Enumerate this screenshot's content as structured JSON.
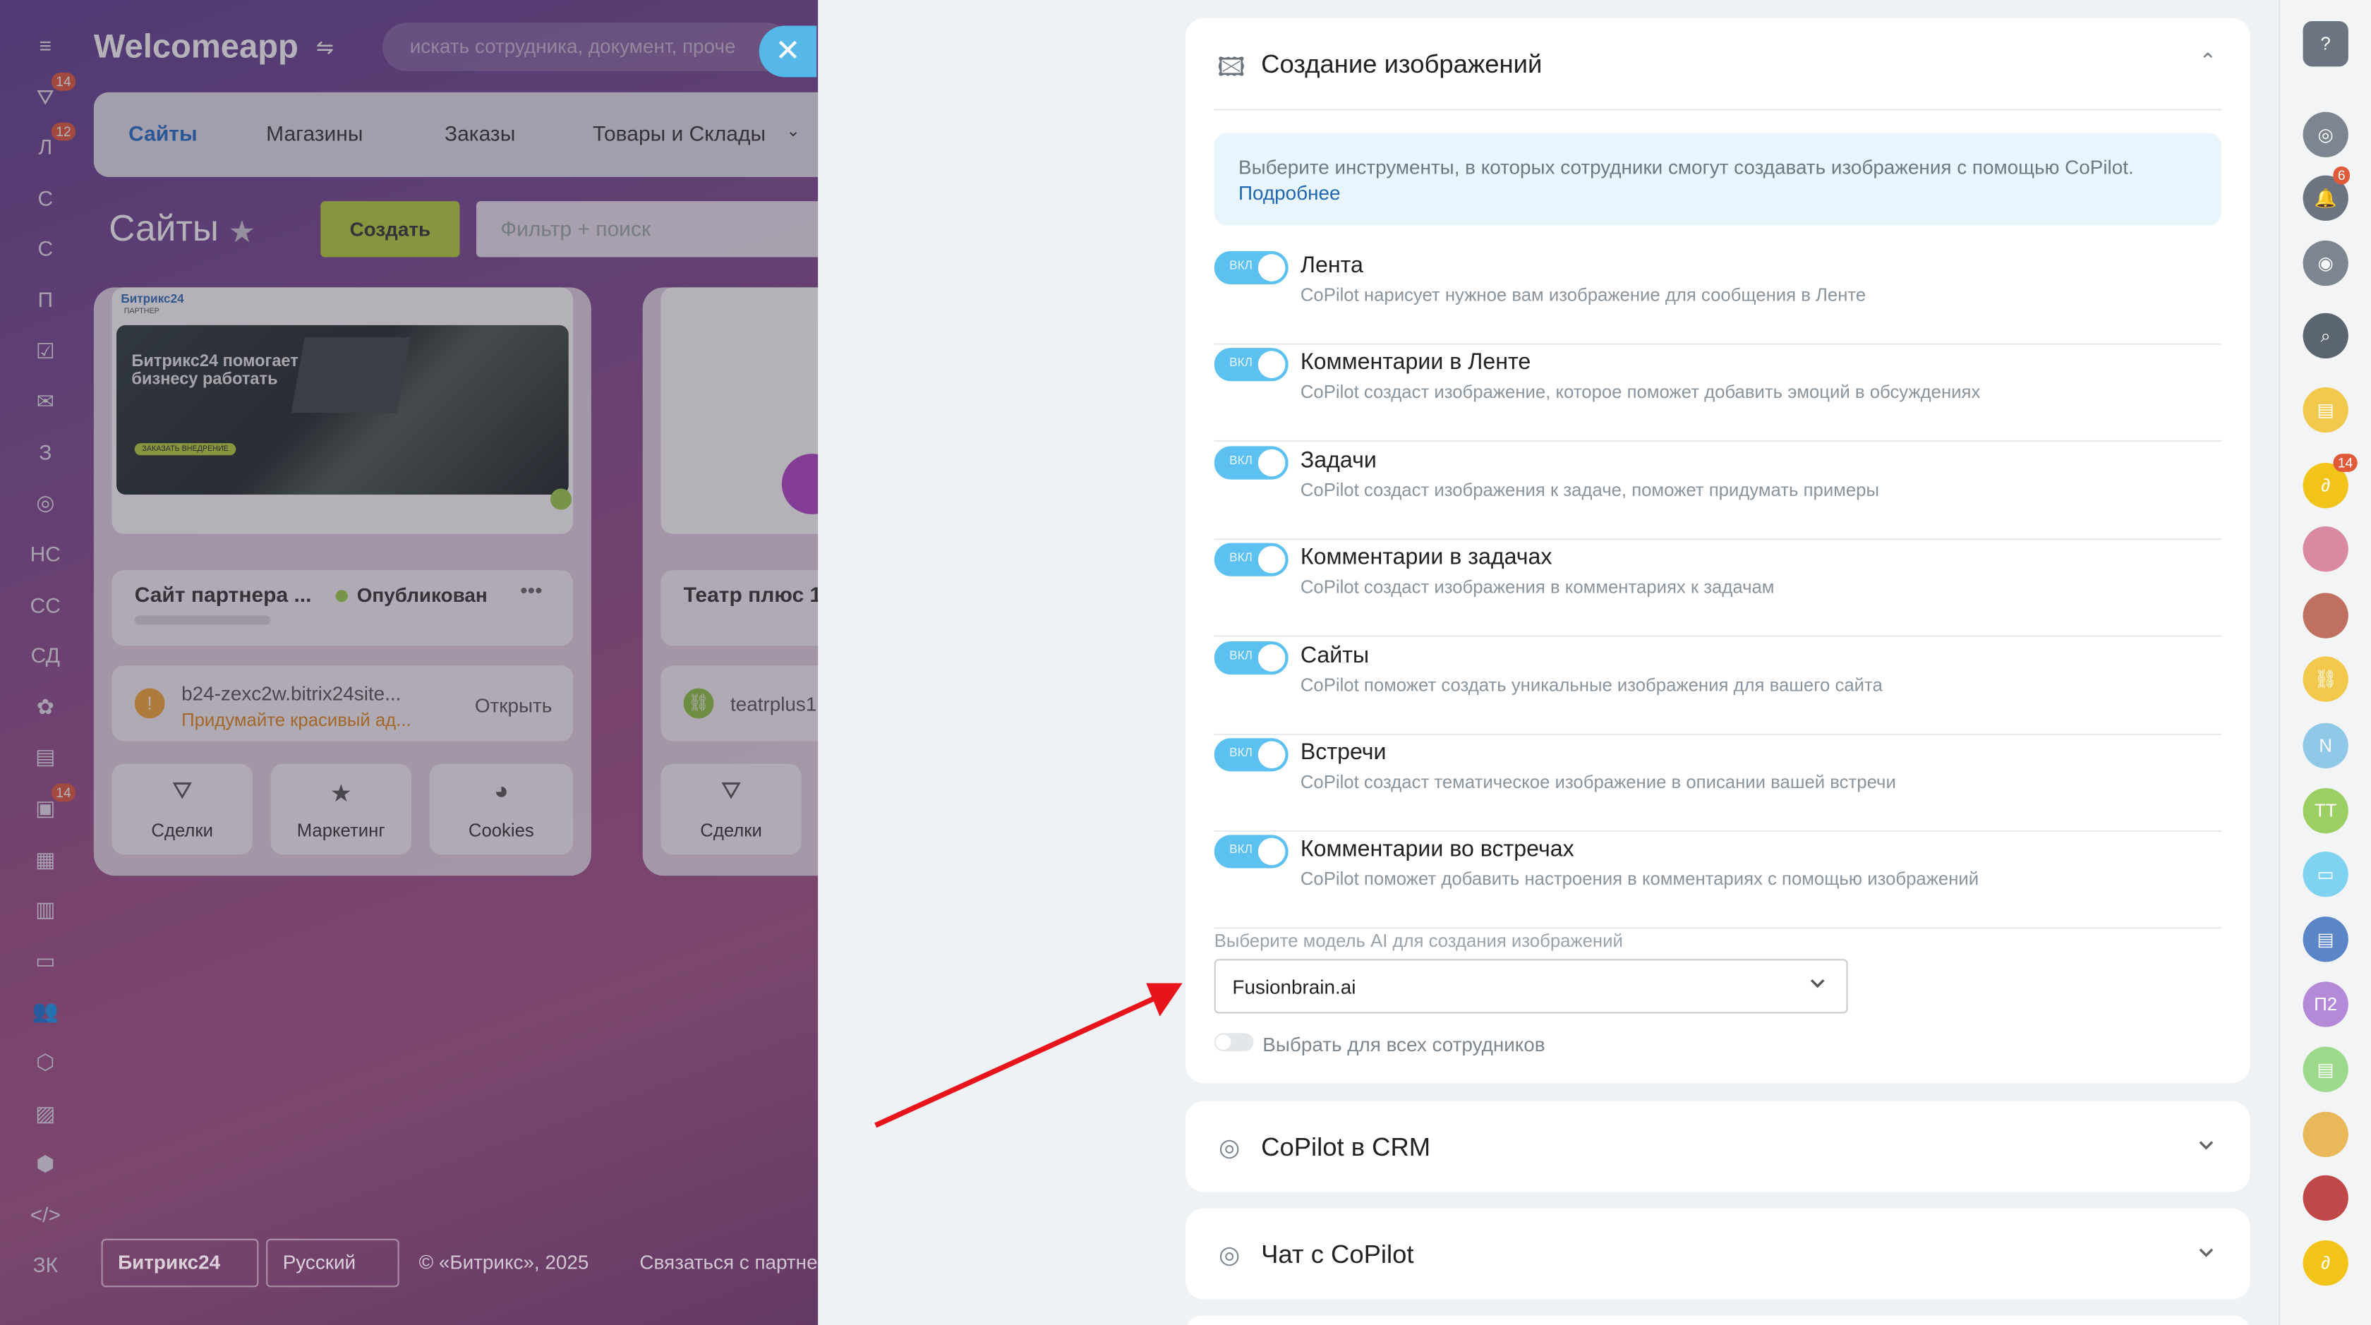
{
  "app": {
    "brand": "Welcomeapp",
    "search_placeholder": "искать сотрудника, документ, проче"
  },
  "leftnav": [
    {
      "label": "≡",
      "badge": ""
    },
    {
      "label": "⛛",
      "badge": "14"
    },
    {
      "label": "Л",
      "badge": "12"
    },
    {
      "label": "С",
      "badge": ""
    },
    {
      "label": "С",
      "badge": ""
    },
    {
      "label": "П",
      "badge": ""
    },
    {
      "label": "☑",
      "badge": ""
    },
    {
      "label": "✉",
      "badge": ""
    },
    {
      "label": "З",
      "badge": ""
    },
    {
      "label": "◎",
      "badge": ""
    },
    {
      "label": "НС",
      "badge": ""
    },
    {
      "label": "СС",
      "badge": ""
    },
    {
      "label": "СД",
      "badge": ""
    },
    {
      "label": "✿",
      "badge": ""
    },
    {
      "label": "▤",
      "badge": ""
    },
    {
      "label": "▣",
      "badge": "14"
    },
    {
      "label": "▦",
      "badge": ""
    },
    {
      "label": "▥",
      "badge": ""
    },
    {
      "label": "▭",
      "badge": ""
    },
    {
      "label": "👥",
      "badge": ""
    },
    {
      "label": "⬡",
      "badge": ""
    },
    {
      "label": "▨",
      "badge": ""
    },
    {
      "label": "⬢",
      "badge": ""
    },
    {
      "label": "</>",
      "badge": ""
    },
    {
      "label": "ЗК",
      "badge": ""
    }
  ],
  "tabs": [
    "Сайты",
    "Магазины",
    "Заказы",
    "Товары и Склады"
  ],
  "page": {
    "title": "Сайты",
    "create": "Создать",
    "filter": "Фильтр + поиск"
  },
  "card1": {
    "thumb_brand": "Битрикс24",
    "thumb_partner": "ПАРТНЕР",
    "thumb_heading": "Битрикс24 помогает бизнесу работать",
    "thumb_btn": "ЗАКАЗАТЬ ВНЕДРЕНИЕ",
    "name": "Сайт партнера ...",
    "status": "Опубликован",
    "url": "b24-zexc2w.bitrix24site...",
    "warning": "Придумайте красивый ад...",
    "open": "Открыть",
    "actions": [
      "Сделки",
      "Маркетинг",
      "Cookies"
    ]
  },
  "card2": {
    "name": "Театр плюс 1",
    "url": "teatrplus1.",
    "actions": [
      "Сделки"
    ]
  },
  "footer": {
    "logo": "Битрикс24",
    "lang": "Русский",
    "copy": "© «Битрикс», 2025",
    "contact": "Связаться с партне"
  },
  "panel": {
    "section_title": "Создание изображений",
    "info": "Выберите инструменты, в которых сотрудники смогут создавать изображения с помощью CoPilot.",
    "info_link": "Подробнее",
    "toggle_text": "ВКЛ",
    "rows": [
      {
        "title": "Лента",
        "desc": "CoPilot нарисует нужное вам изображение для сообщения в Ленте"
      },
      {
        "title": "Комментарии в Ленте",
        "desc": "CoPilot создаст изображение, которое поможет добавить эмоций в обсуждениях"
      },
      {
        "title": "Задачи",
        "desc": "CoPilot создаст изображения к задаче, поможет придумать примеры"
      },
      {
        "title": "Комментарии в задачах",
        "desc": "CoPilot создаст изображения в комментариях к задачам"
      },
      {
        "title": "Сайты",
        "desc": "CoPilot поможет создать уникальные изображения для вашего сайта"
      },
      {
        "title": "Встречи",
        "desc": "CoPilot создаст тематическое изображение в описании вашей встречи"
      },
      {
        "title": "Комментарии во встречах",
        "desc": "CoPilot поможет добавить настроения в комментариях с помощью изображений"
      }
    ],
    "model_label": "Выберите модель AI для создания изображений",
    "model_value": "Fusionbrain.ai",
    "all_label": "Выбрать для всех сотрудников",
    "accordions": [
      "CoPilot в CRM",
      "Чат с CoPilot"
    ]
  },
  "rail": [
    {
      "name": "help-icon",
      "label": "?",
      "color": "#6b7480",
      "badge": ""
    },
    {
      "name": "copilot-icon",
      "label": "◎",
      "color": "#7d8590",
      "badge": ""
    },
    {
      "name": "bell-icon",
      "label": "🔔",
      "color": "#6b7480",
      "badge": "6"
    },
    {
      "name": "chat-icon",
      "label": "◉",
      "color": "#7d8590",
      "badge": ""
    },
    {
      "name": "search-icon",
      "label": "⌕",
      "color": "#5b6570",
      "badge": ""
    },
    {
      "name": "notes-icon",
      "label": "▤",
      "color": "#f2c94c",
      "badge": ""
    },
    {
      "name": "app-icon",
      "label": "∂",
      "color": "#f2c318",
      "badge": "14"
    },
    {
      "name": "avatar-1",
      "label": "",
      "color": "#d98aa0",
      "badge": ""
    },
    {
      "name": "avatar-2",
      "label": "",
      "color": "#c07060",
      "badge": ""
    },
    {
      "name": "link-icon",
      "label": "⛓",
      "color": "#f2c94c",
      "badge": ""
    },
    {
      "name": "avatar-n",
      "label": "N",
      "color": "#90c8e8",
      "badge": ""
    },
    {
      "name": "avatar-tt",
      "label": "TT",
      "color": "#9ccf63",
      "badge": ""
    },
    {
      "name": "chat-green-icon",
      "label": "▭",
      "color": "#7fd3f0",
      "badge": ""
    },
    {
      "name": "doc-icon",
      "label": "▤",
      "color": "#5a86c8",
      "badge": ""
    },
    {
      "name": "avatar-p2",
      "label": "П2",
      "color": "#b48ad8",
      "badge": ""
    },
    {
      "name": "note-green-icon",
      "label": "▤",
      "color": "#9cd98a",
      "badge": ""
    },
    {
      "name": "avatar-3",
      "label": "",
      "color": "#e8b85a",
      "badge": ""
    },
    {
      "name": "avatar-4",
      "label": "",
      "color": "#c04848",
      "badge": ""
    },
    {
      "name": "app-icon-2",
      "label": "∂",
      "color": "#f2c318",
      "badge": ""
    }
  ]
}
